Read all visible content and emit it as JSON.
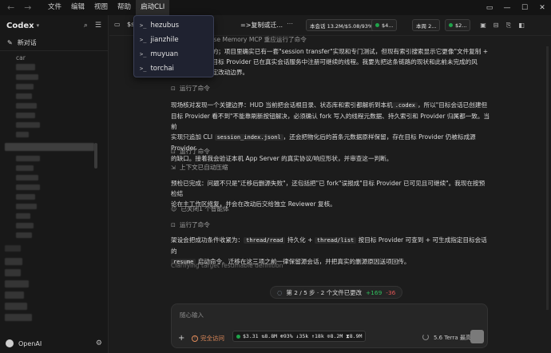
{
  "menu": [
    "文件",
    "编辑",
    "视图",
    "帮助",
    "启动CLI"
  ],
  "sidebar": {
    "title": "Codex",
    "new_chat": "新对话",
    "first_item": "car",
    "user": "OpenAI"
  },
  "header": {
    "title": "$s",
    "title_suffix": "=>复制或迁...",
    "title_prefix": "base Memory MCP 重应运行了命令",
    "pill_total": "本会话 13.2M/$5.08/93%",
    "pill_today": "$4...",
    "pill_week": "本周 2...",
    "pill_month": "$2..."
  },
  "dropdown": {
    "items": [
      "hezubus",
      "jianzhile",
      "muyuan",
      "torchai"
    ]
  },
  "messages": {
    "intro_line1": "静的；项目里确实已有一套\"session transfer\"实现和专门测试，但现有索引搜索显示它更像\"文件复制 +",
    "intro_line2": "于目标 Provider 已在真实会话服务中注册可继续的线程。我要先把这条链路的现状和此前未完成的风",
    "intro_line3": "决定改动边界。",
    "meta1": "运行了命令",
    "p1": [
      "现场核对发现一个关键边界：HUD 当前把会话根目录、状态库和索引都解析到本机",
      ".codex",
      "，所以\"目标会话已创建但",
      "目标 Provider 看不到\"不能靠刷新按钮解决，必须确认 fork 写入的线程元数据、持久索引和 Provider 归属都一致。当前",
      "实现只追加 CLI",
      "session_index.jsonl",
      "，还会把物化后的首条元数据原样保留，存在目标 Provider 仍被标成源 Provider",
      "的缺口。接着我会验证本机 App Server 的真实协议/响应形状，并审查这一判断。"
    ],
    "meta2": "运行了命令",
    "meta3": "上下文已自动压缩",
    "p2_line1": "预检已完成：问题不只是\"迁移后删源失败\"，还包括把\"已 fork\"误报成\"目标 Provider 已可见且可继续\"。我现在按预检结",
    "p2_line2": "论在主工作区修复，并会在改动后交给独立 Reviewer 复核。",
    "meta4": "已关闭1 个智能体",
    "meta5": "运行了命令",
    "p3": [
      "架设会把成功条件收紧为：",
      "thread/read",
      "持久化 +",
      "thread/list",
      "按目标 Provider 可查到 + 可生成指定目标会话的",
      "resume",
      "启动命令。迁移在这三项之前一律保留源会话，并把真实的删源原因送项回传。"
    ],
    "faint": "Clarifying target resumable definition"
  },
  "steps": {
    "label": "第 2 / 5 步 · 2 个文件已更改",
    "add": "+169",
    "del": "-36"
  },
  "composer": {
    "placeholder": "随心输入",
    "access": "完全访问",
    "stats": "$3.31 ⇅8.8M ⊕93% ↓35k ↑18k ⊙8.2M ⧗8.9M",
    "model": "5.6 Terra  最高"
  }
}
